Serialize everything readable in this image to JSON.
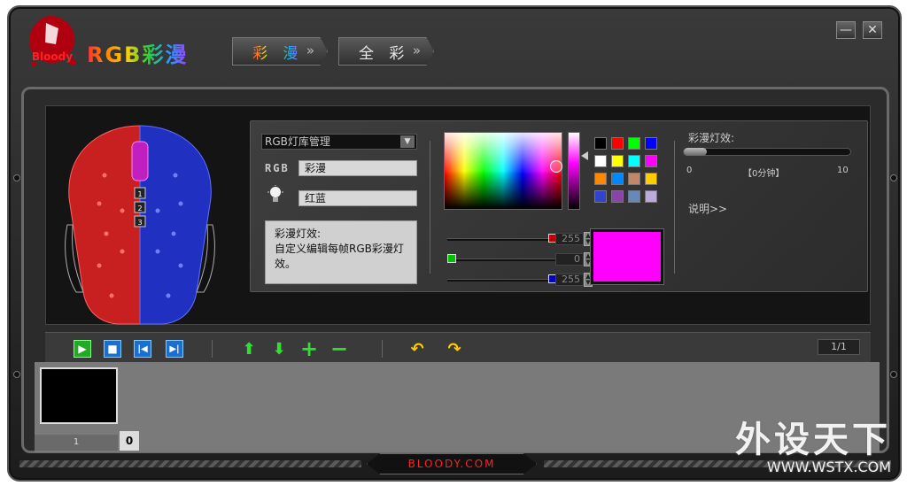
{
  "app": {
    "title": "RGB彩漫",
    "logo_text": "Bloody"
  },
  "tabs": [
    {
      "label": "彩 漫",
      "active": true
    },
    {
      "label": "全 彩",
      "active": false
    }
  ],
  "window_controls": {
    "minimize": "—",
    "close": "✕"
  },
  "editor": {
    "library_select": "RGB灯库管理",
    "rgb_label": "RGB",
    "rgb_name": "彩漫",
    "light_name": "红蓝",
    "description": "彩漫灯效:\n自定义编辑每帧RGB彩漫灯效。"
  },
  "color": {
    "selected": "#ff00ff",
    "r": "255",
    "g": "0",
    "b": "255",
    "r_fraction": 1.0,
    "g_fraction": 0.0,
    "b_fraction": 1.0,
    "swatches": [
      "#000000",
      "#ff0000",
      "#00ff00",
      "#0000ff",
      "#ffffff",
      "#ffff00",
      "#00ffff",
      "#ff00ff",
      "#ff8800",
      "#0088ff",
      "#c08868",
      "#ffcc00",
      "#3344cc",
      "#8844aa",
      "#6688bb",
      "#bbaadd"
    ]
  },
  "effect": {
    "title": "彩漫灯效:",
    "min": "0",
    "max": "10",
    "current": "【0分钟】",
    "help": "说明>>"
  },
  "toolbar": {
    "page": "1/1"
  },
  "frames": [
    {
      "number": "1",
      "duration": "0"
    }
  ],
  "footer": {
    "brand": "BLOODY.COM"
  },
  "watermark": {
    "line1": "外设天下",
    "line2": "WWW.WSTX.COM"
  }
}
